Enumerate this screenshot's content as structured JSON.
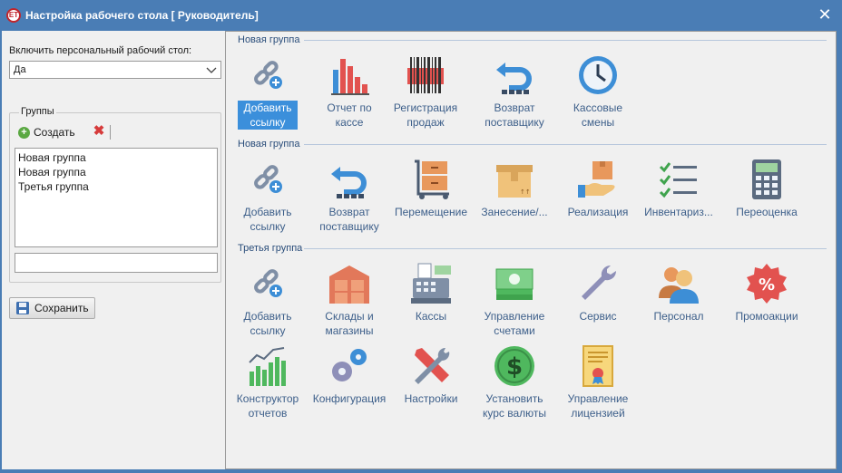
{
  "window": {
    "title": "Настройка рабочего стола [  Руководитель]",
    "app_icon_text": "ЕТ"
  },
  "left": {
    "enable_label": "Включить персональный рабочий стол:",
    "enable_value": "Да",
    "groups_legend": "Группы",
    "create_label": "Создать",
    "group_list": [
      "Новая группа",
      "Новая группа",
      "Третья группа"
    ],
    "group_name_input": "",
    "save_label": "Сохранить"
  },
  "sections": [
    {
      "title": "Новая группа",
      "tiles": [
        {
          "label": "Добавить\nссылку",
          "icon": "link-add-icon",
          "selected": true
        },
        {
          "label": "Отчет по\nкассе",
          "icon": "bar-chart-icon"
        },
        {
          "label": "Регистрация\nпродаж",
          "icon": "barcode-icon"
        },
        {
          "label": "Возврат\nпоставщику",
          "icon": "return-arrow-icon"
        },
        {
          "label": "Кассовые\nсмены",
          "icon": "clock-icon"
        }
      ]
    },
    {
      "title": "Новая группа",
      "tiles": [
        {
          "label": "Добавить\nссылку",
          "icon": "link-add-icon"
        },
        {
          "label": "Возврат\nпоставщику",
          "icon": "return-arrow-icon"
        },
        {
          "label": "Перемещение",
          "icon": "cart-icon"
        },
        {
          "label": "Занесение/...",
          "icon": "box-icon"
        },
        {
          "label": "Реализация",
          "icon": "hand-box-icon"
        },
        {
          "label": "Инвентариз...",
          "icon": "checklist-icon"
        },
        {
          "label": "Переоценка",
          "icon": "calculator-icon"
        }
      ]
    },
    {
      "title": "Третья группа",
      "tiles": [
        {
          "label": "Добавить\nссылку",
          "icon": "link-add-icon"
        },
        {
          "label": "Склады и\nмагазины",
          "icon": "warehouse-icon"
        },
        {
          "label": "Кассы",
          "icon": "cash-register-icon"
        },
        {
          "label": "Управление\nсчетами",
          "icon": "money-icon"
        },
        {
          "label": "Сервис",
          "icon": "wrench-icon"
        },
        {
          "label": "Персонал",
          "icon": "people-icon"
        },
        {
          "label": "Промоакции",
          "icon": "percent-badge-icon"
        },
        {
          "label": "Конструктор\nотчетов",
          "icon": "report-chart-icon"
        },
        {
          "label": "Конфигурация",
          "icon": "gears-icon"
        },
        {
          "label": "Настройки",
          "icon": "tools-icon"
        },
        {
          "label": "Установить\nкурс валюты",
          "icon": "dollar-coin-icon"
        },
        {
          "label": "Управление\nлицензией",
          "icon": "certificate-icon"
        }
      ]
    }
  ]
}
